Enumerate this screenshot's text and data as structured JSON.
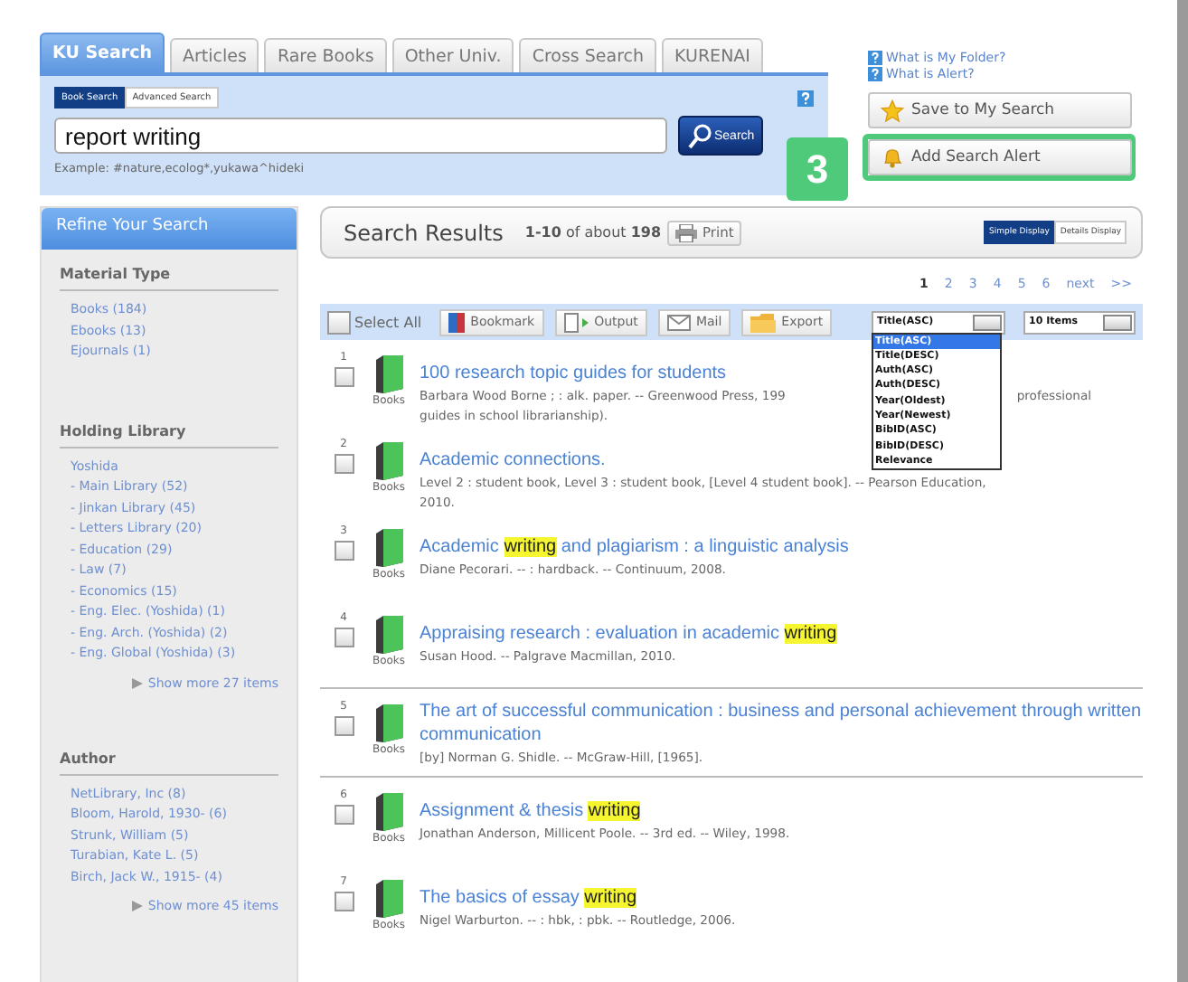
{
  "tabs": [
    {
      "label": "KU Search",
      "selected": true
    },
    {
      "label": "Articles",
      "selected": false
    },
    {
      "label": "Rare Books",
      "selected": false
    },
    {
      "label": "Other Univ.",
      "selected": false
    },
    {
      "label": "Cross Search",
      "selected": false
    },
    {
      "label": "KURENAI",
      "selected": false
    }
  ],
  "search_modes": [
    {
      "label": "Book Search",
      "selected": true
    },
    {
      "label": "Advanced Search",
      "selected": false
    }
  ],
  "search": {
    "value": "report writing",
    "button": "Search",
    "example": "Example: #nature,ecolog*,yukawa^hideki"
  },
  "help_links": [
    "What is My Folder?",
    "What is Alert?"
  ],
  "actions": [
    {
      "label": "Save to My Search",
      "kind": "star",
      "highlighted": false
    },
    {
      "label": "Add Search Alert",
      "kind": "bell",
      "highlighted": true
    }
  ],
  "callout": "3",
  "refine": {
    "title": "Refine Your Search",
    "sections": [
      {
        "heading": "Material Type",
        "items": [
          {
            "label": "Books (184)"
          },
          {
            "label": "Ebooks (13)"
          },
          {
            "label": "Ejournals (1)"
          }
        ]
      },
      {
        "heading": "Holding Library",
        "items": [
          {
            "label": "Yoshida",
            "children": [
              {
                "label": "- Main Library (52)"
              },
              {
                "label": "- Jinkan Library (45)"
              },
              {
                "label": "- Letters Library (20)"
              },
              {
                "label": "- Education (29)"
              },
              {
                "label": "- Law (7)"
              },
              {
                "label": "- Economics (15)"
              },
              {
                "label": "- Eng. Elec. (Yoshida) (1)"
              },
              {
                "label": "- Eng. Arch. (Yoshida) (2)"
              },
              {
                "label": "- Eng. Global (Yoshida) (3)"
              }
            ]
          }
        ],
        "more": "Show more 27 items"
      },
      {
        "heading": "Author",
        "items": [
          {
            "label": "NetLibrary, Inc (8)"
          },
          {
            "label": "Bloom, Harold, 1930- (6)"
          },
          {
            "label": "Strunk, William (5)"
          },
          {
            "label": "Turabian, Kate L. (5)"
          },
          {
            "label": "Birch, Jack W., 1915- (4)"
          }
        ],
        "more": "Show more 45 items"
      }
    ]
  },
  "results_header": {
    "title": "Search Results",
    "summary": "**1-10** of about **198**",
    "print": "Print"
  },
  "display_modes": [
    {
      "label": "Simple Display",
      "selected": true
    },
    {
      "label": "Details Display",
      "selected": false
    }
  ],
  "pages": [
    {
      "label": "1",
      "selected": true
    },
    {
      "label": "2",
      "selected": false
    },
    {
      "label": "3",
      "selected": false
    },
    {
      "label": "4",
      "selected": false
    },
    {
      "label": "5",
      "selected": false
    },
    {
      "label": "6",
      "selected": false
    },
    {
      "label": "next",
      "selected": false
    },
    {
      "label": ">>",
      "selected": false
    }
  ],
  "toolbar": {
    "select_all": {
      "label": "Select All",
      "checked": false
    },
    "buttons": [
      {
        "label": "Bookmark",
        "kind": "bookmark"
      },
      {
        "label": "Output",
        "kind": "output"
      },
      {
        "label": "Mail",
        "kind": "mail"
      },
      {
        "label": "Export",
        "kind": "export"
      }
    ],
    "sort": {
      "value": "Title(ASC)",
      "expanded": true,
      "options": [
        {
          "label": "Title(ASC)",
          "selected": true
        },
        {
          "label": "Title(DESC)",
          "selected": false
        },
        {
          "label": "Auth(ASC)",
          "selected": false
        },
        {
          "label": "Auth(DESC)",
          "selected": false
        },
        {
          "label": "Year(Oldest)",
          "selected": false
        },
        {
          "label": "Year(Newest)",
          "selected": false
        },
        {
          "label": "BibID(ASC)",
          "selected": false
        },
        {
          "label": "BibID(DESC)",
          "selected": false
        },
        {
          "label": "Relevance",
          "selected": false
        }
      ]
    },
    "per_page": {
      "value": "10 Items"
    }
  },
  "results": [
    {
      "number": "1",
      "type": "Books",
      "checked": false,
      "divider": false,
      "title": [
        {
          "text": "100 research topic guides for students",
          "highlight": false
        }
      ],
      "description_lines": [
        [
          "Barbara Wood Borne ; : alk. paper. -- Greenwood Press, 199",
          "professional"
        ],
        [
          "guides in school librarianship)."
        ]
      ]
    },
    {
      "number": "2",
      "type": "Books",
      "checked": false,
      "divider": false,
      "title": [
        {
          "text": "Academic connections.",
          "highlight": false
        }
      ],
      "description_lines": [
        [
          "Level 2 : student book, Level 3 : student book, [Level 4 student book]. -- Pearson Education,"
        ],
        [
          "2010."
        ]
      ]
    },
    {
      "number": "3",
      "type": "Books",
      "checked": false,
      "divider": false,
      "title": [
        {
          "text": "Academic ",
          "highlight": false
        },
        {
          "text": "writing",
          "highlight": true
        },
        {
          "text": " and plagiarism : a linguistic analysis",
          "highlight": false
        }
      ],
      "description_lines": [
        [
          "Diane Pecorari. -- : hardback. -- Continuum, 2008."
        ]
      ]
    },
    {
      "number": "4",
      "type": "Books",
      "checked": false,
      "divider": false,
      "title": [
        {
          "text": "Appraising research : evaluation in academic ",
          "highlight": false
        },
        {
          "text": "writing",
          "highlight": true
        }
      ],
      "description_lines": [
        [
          "Susan Hood. -- Palgrave Macmillan, 2010."
        ]
      ]
    },
    {
      "number": "5",
      "type": "Books",
      "checked": false,
      "divider": true,
      "title": [
        {
          "text": "The art of successful communication : business and personal achievement through written communication",
          "highlight": false
        }
      ],
      "description_lines": [
        [
          "[by] Norman G. Shidle. -- McGraw-Hill, [1965]."
        ]
      ]
    },
    {
      "number": "6",
      "type": "Books",
      "checked": false,
      "divider": true,
      "title": [
        {
          "text": "Assignment & thesis ",
          "highlight": false
        },
        {
          "text": "writing",
          "highlight": true
        }
      ],
      "description_lines": [
        [
          "Jonathan Anderson, Millicent Poole. -- 3rd ed. -- Wiley, 1998."
        ]
      ]
    },
    {
      "number": "7",
      "type": "Books",
      "checked": false,
      "divider": false,
      "title": [
        {
          "text": "The basics of essay ",
          "highlight": false
        },
        {
          "text": "writing",
          "highlight": true
        }
      ],
      "description_lines": [
        [
          "Nigel Warburton. -- : hbk, : pbk. -- Routledge, 2006."
        ]
      ]
    }
  ]
}
